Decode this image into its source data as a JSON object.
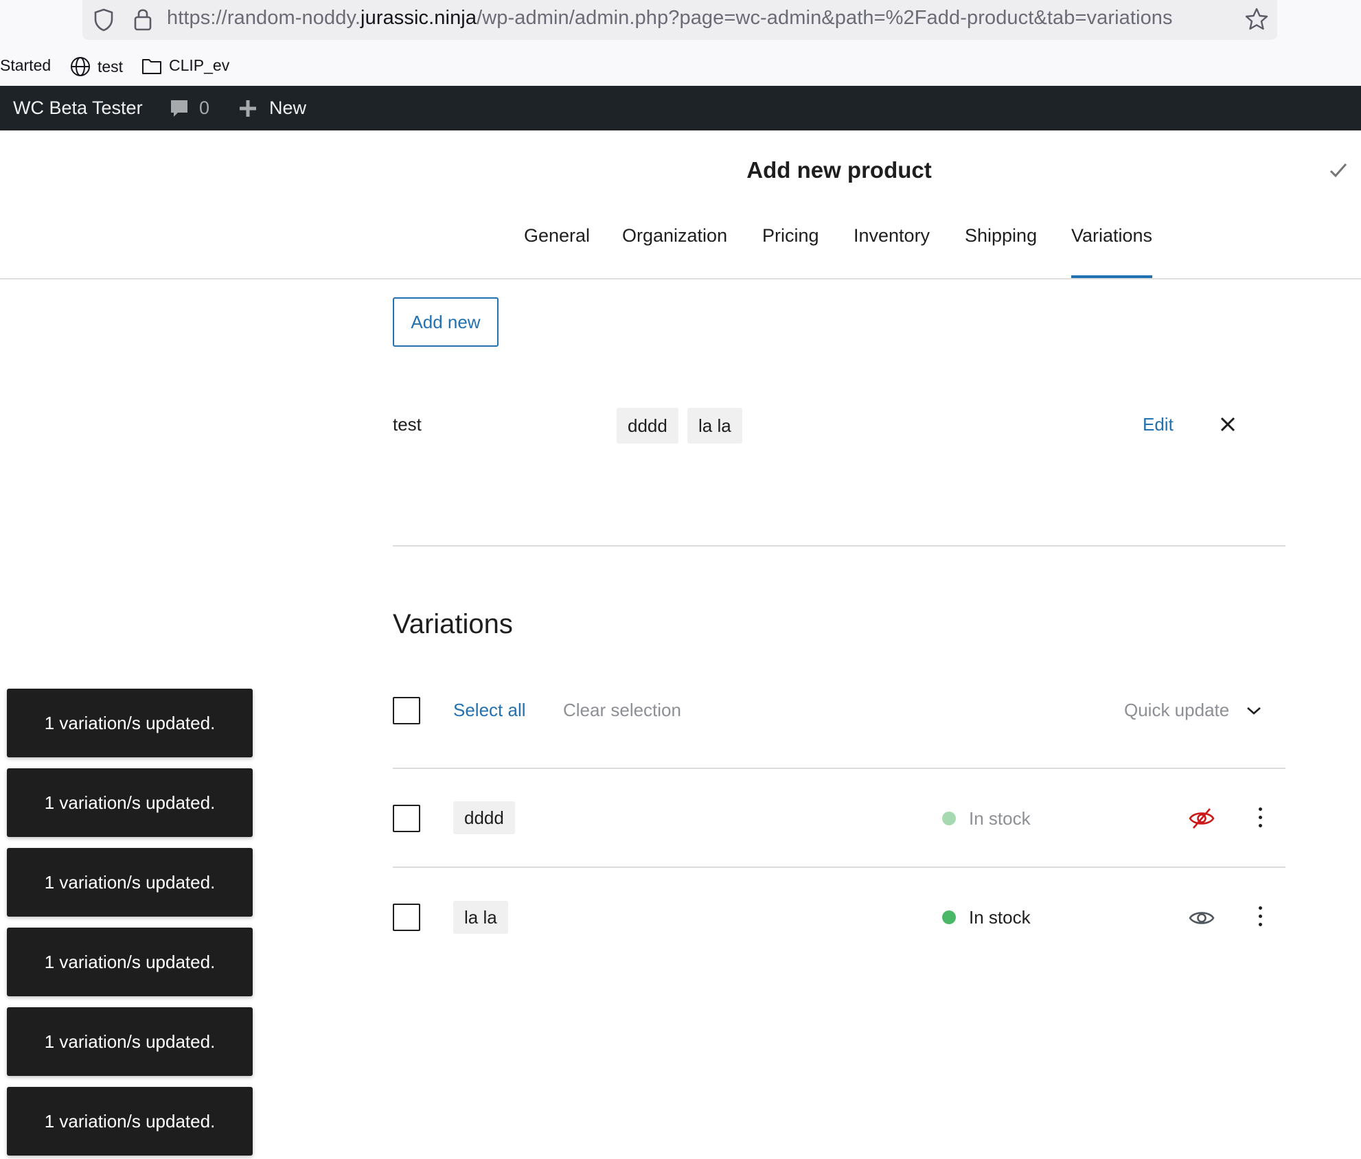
{
  "browser": {
    "url_prefix": "https://random-noddy.",
    "url_domain": "jurassic.ninja",
    "url_path": "/wp-admin/admin.php?page=wc-admin&path=%2Fadd-product&tab=variations",
    "bookmarks": [
      {
        "label": "Started",
        "icon": "none"
      },
      {
        "label": "test",
        "icon": "globe-icon"
      },
      {
        "label": "CLIP_ev",
        "icon": "folder-icon"
      }
    ]
  },
  "adminbar": {
    "site_name": "WC Beta Tester",
    "comments_count": "0",
    "new_label": "New"
  },
  "header": {
    "title": "Add new product",
    "tabs": [
      {
        "label": "General"
      },
      {
        "label": "Organization"
      },
      {
        "label": "Pricing"
      },
      {
        "label": "Inventory"
      },
      {
        "label": "Shipping"
      },
      {
        "label": "Variations"
      }
    ],
    "active_tab": "Variations"
  },
  "attributes": {
    "add_new_label": "Add new",
    "items": [
      {
        "name": "test",
        "values": [
          "dddd",
          "la la"
        ],
        "edit_label": "Edit"
      }
    ]
  },
  "variations": {
    "heading": "Variations",
    "select_all_label": "Select all",
    "clear_selection_label": "Clear selection",
    "quick_update_label": "Quick update",
    "rows": [
      {
        "option": "dddd",
        "stock_status": "In stock",
        "visible": false,
        "stock_color": "#a7d9b0"
      },
      {
        "option": "la la",
        "stock_status": "In stock",
        "visible": true,
        "stock_color": "#4ab866"
      }
    ]
  },
  "snackbars": [
    "1 variation/s updated.",
    "1 variation/s updated.",
    "1 variation/s updated.",
    "1 variation/s updated.",
    "1 variation/s updated.",
    "1 variation/s updated."
  ],
  "colors": {
    "accent": "#2271b1",
    "adminbar_bg": "#1d2327",
    "hidden_icon": "#cc1818"
  }
}
